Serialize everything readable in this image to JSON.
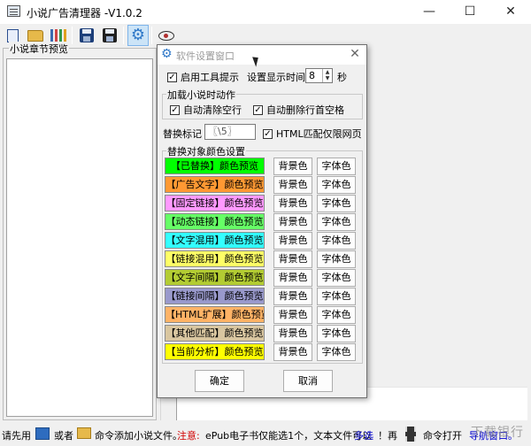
{
  "window": {
    "title": "小说广告清理器 -V1.0.2",
    "minimize": "—",
    "maximize": "☐",
    "close": "✕"
  },
  "preview": {
    "title": "小说章节预览"
  },
  "status": {
    "part1": "请先用",
    "part2": "或者",
    "part3": "命令添加小说文件。",
    "notice": "注意:",
    "part4": "ePub电子书仅能选1个，文本文件可以",
    "multi": "多选",
    "part5": "！再",
    "part6": "命令打开",
    "nav": "导航窗口。",
    "watermark": "下载银行"
  },
  "dialog": {
    "title": "软件设置窗口",
    "close": "✕",
    "tooltip_checkbox": "启用工具提示",
    "tooltip_checked": "✓",
    "display_time_label": "设置显示时间",
    "display_time_value": "8",
    "display_time_unit": "秒",
    "load_group": "加载小说时动作",
    "auto_clear_blank": "自动清除空行",
    "auto_clear_blank_checked": "✓",
    "auto_delete_space": "自动删除行首空格",
    "auto_delete_space_checked": "✓",
    "replace_mark_label": "替换标记",
    "replace_mark_value": "〖\\5〗",
    "html_only": "HTML匹配仅限网页",
    "html_only_checked": "✓",
    "color_group": "替换对象颜色设置",
    "bg_button": "背景色",
    "fg_button": "字体色",
    "ok": "确定",
    "cancel": "取消",
    "color_rows": [
      {
        "label": "【已替换】颜色预览",
        "bg": "#00ff00"
      },
      {
        "label": "【广告文字】颜色预览",
        "bg": "#ff9933"
      },
      {
        "label": "【固定链接】颜色预览",
        "bg": "#ff99ff"
      },
      {
        "label": "【动态链接】颜色预览",
        "bg": "#66ff66"
      },
      {
        "label": "【文字混用】颜色预览",
        "bg": "#33ffff"
      },
      {
        "label": "【链接混用】颜色预览",
        "bg": "#ffff66"
      },
      {
        "label": "【文字间隔】颜色预览",
        "bg": "#b3cc33"
      },
      {
        "label": "【链接间隔】颜色预览",
        "bg": "#9999cc"
      },
      {
        "label": "【HTML扩展】颜色预览",
        "bg": "#ffb366"
      },
      {
        "label": "【其他匹配】颜色预览",
        "bg": "#d9c6a0"
      },
      {
        "label": "【当前分析】颜色预览",
        "bg": "#ffff00"
      }
    ]
  }
}
